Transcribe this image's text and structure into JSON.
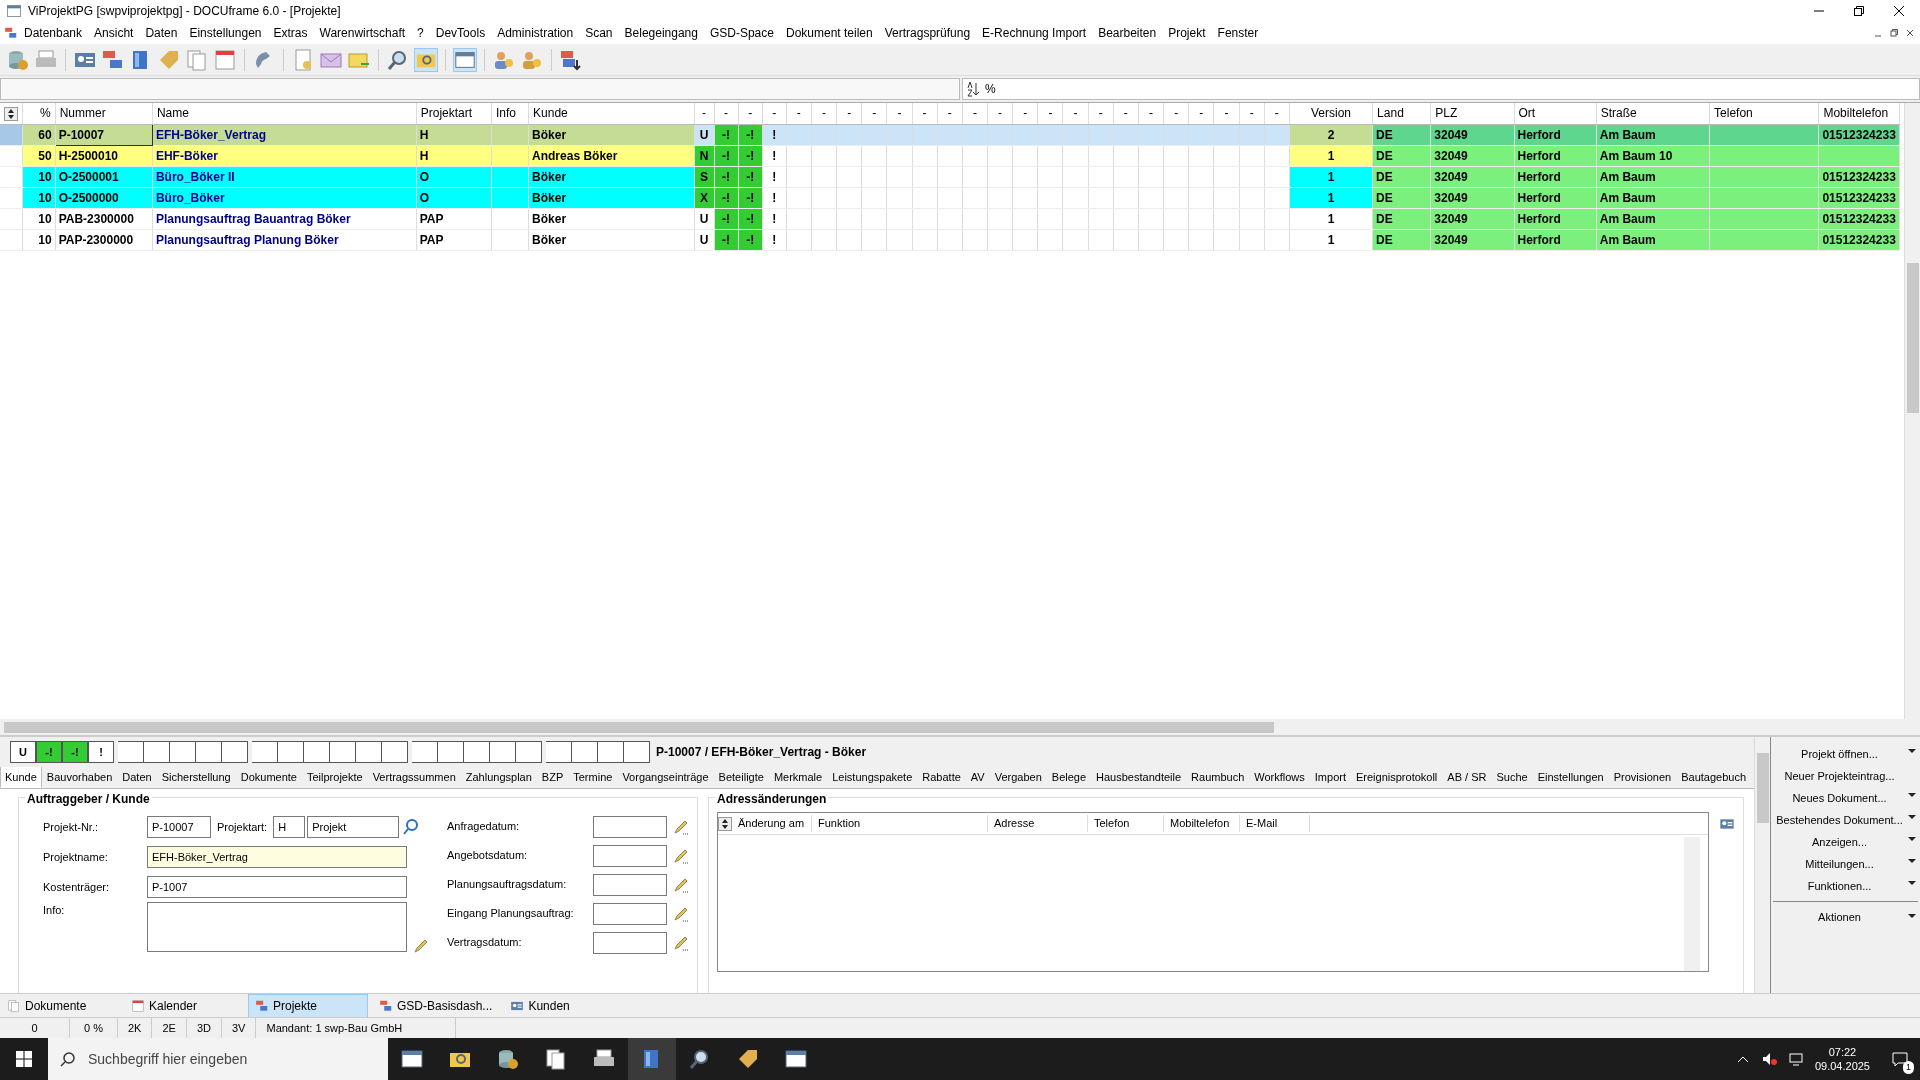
{
  "window": {
    "title": "ViProjektPG [swpviprojektpg] - DOCUframe 6.0 - [Projekte]"
  },
  "menu": [
    "Datenbank",
    "Ansicht",
    "Daten",
    "Einstellungen",
    "Extras",
    "Warenwirtschaft",
    "?",
    "DevTools",
    "Administration",
    "Scan",
    "Belegeingang",
    "GSD-Space",
    "Dokument teilen",
    "Vertragsprüfung",
    "E-Rechnung Import",
    "Bearbeiten",
    "Projekt",
    "Fenster"
  ],
  "filter": {
    "value": "%"
  },
  "table": {
    "columns": [
      "%",
      "Nummer",
      "Name",
      "Projektart",
      "Info",
      "Kunde",
      "-",
      "-",
      "-",
      "-",
      "-",
      "-",
      "-",
      "-",
      "-",
      "-",
      "-",
      "-",
      "-",
      "-",
      "-",
      "-",
      "-",
      "-",
      "-",
      "-",
      "-",
      "-",
      "-",
      "-",
      "Version",
      "Land",
      "PLZ",
      "Ort",
      "Straße",
      "Telefon",
      "Mobiltelefon"
    ],
    "rows": [
      {
        "pct": "60",
        "nummer": "P-10007",
        "name": "EFH-Böker_Vertrag",
        "projektart": "H",
        "kunde": "Böker",
        "marks": [
          "U",
          "-!",
          "-!",
          "!"
        ],
        "status_highlight": false,
        "version": "2",
        "land": "DE",
        "plz": "32049",
        "ort": "Herford",
        "strasse": "Am Baum",
        "mobil": "01512324233",
        "color": "#c4dc94",
        "selected": true
      },
      {
        "pct": "50",
        "nummer": "H-2500010",
        "name": "EHF-Böker",
        "projektart": "H",
        "kunde": "Andreas Böker",
        "marks": [
          "N",
          "-!",
          "-!",
          "!"
        ],
        "status_highlight": true,
        "version": "1",
        "land": "DE",
        "plz": "32049",
        "ort": "Herford",
        "strasse": "Am Baum 10",
        "color": "#ffff80",
        "selected": false
      },
      {
        "pct": "10",
        "nummer": "O-2500001",
        "name": "Büro_Böker II",
        "projektart": "O",
        "kunde": "Böker",
        "marks": [
          "S",
          "-!",
          "-!",
          "!"
        ],
        "status_highlight": true,
        "version": "1",
        "land": "DE",
        "plz": "32049",
        "ort": "Herford",
        "strasse": "Am Baum",
        "mobil": "01512324233",
        "color": "#00ffff",
        "selected": false
      },
      {
        "pct": "10",
        "nummer": "O-2500000",
        "name": "Büro_Böker",
        "projektart": "O",
        "kunde": "Böker",
        "marks": [
          "X",
          "-!",
          "-!",
          "!"
        ],
        "status_highlight": true,
        "version": "1",
        "land": "DE",
        "plz": "32049",
        "ort": "Herford",
        "strasse": "Am Baum",
        "mobil": "01512324233",
        "color": "#00ffff",
        "selected": false
      },
      {
        "pct": "10",
        "nummer": "PAB-2300000",
        "name": "Planungsauftrag Bauantrag Böker",
        "projektart": "PAP",
        "kunde": "Böker",
        "marks": [
          "U",
          "-!",
          "-!",
          "!"
        ],
        "status_highlight": false,
        "version": "1",
        "land": "DE",
        "plz": "32049",
        "ort": "Herford",
        "strasse": "Am Baum",
        "mobil": "01512324233",
        "selected": false
      },
      {
        "pct": "10",
        "nummer": "PAP-2300000",
        "name": "Planungsauftrag Planung Böker",
        "projektart": "PAP",
        "kunde": "Böker",
        "marks": [
          "U",
          "-!",
          "-!",
          "!"
        ],
        "status_highlight": false,
        "version": "1",
        "land": "DE",
        "plz": "32049",
        "ort": "Herford",
        "strasse": "Am Baum",
        "mobil": "01512324233",
        "selected": false
      }
    ]
  },
  "record": {
    "flags": [
      "U",
      "-!",
      "-!",
      "!"
    ],
    "title": "P-10007 / EFH-Böker_Vertrag - Böker"
  },
  "tabs": [
    {
      "label": "Kunde",
      "selected": true
    },
    {
      "label": "Bauvorhaben",
      "selected": false
    },
    {
      "label": "Daten",
      "selected": false
    },
    {
      "label": "Sicherstellung",
      "selected": false
    },
    {
      "label": "Dokumente",
      "selected": false
    },
    {
      "label": "Teilprojekte",
      "selected": false
    },
    {
      "label": "Vertragssummen",
      "selected": false
    },
    {
      "label": "Zahlungsplan",
      "selected": false
    },
    {
      "label": "BZP",
      "selected": false
    },
    {
      "label": "Termine",
      "selected": false
    },
    {
      "label": "Vorgangseinträge",
      "selected": false
    },
    {
      "label": "Beteiligte",
      "selected": false
    },
    {
      "label": "Merkmale",
      "selected": false
    },
    {
      "label": "Leistungspakete",
      "selected": false
    },
    {
      "label": "Rabatte",
      "selected": false
    },
    {
      "label": "AV",
      "selected": false
    },
    {
      "label": "Vergaben",
      "selected": false
    },
    {
      "label": "Belege",
      "selected": false
    },
    {
      "label": "Hausbestandteile",
      "selected": false
    },
    {
      "label": "Raumbuch",
      "selected": false
    },
    {
      "label": "Workflows",
      "selected": false
    },
    {
      "label": "Import",
      "selected": false
    },
    {
      "label": "Ereignisprotokoll",
      "selected": false
    },
    {
      "label": "AB / SR",
      "selected": false
    },
    {
      "label": "Suche",
      "selected": false
    },
    {
      "label": "Einstellungen",
      "selected": false
    },
    {
      "label": "Provisionen",
      "selected": false
    },
    {
      "label": "Bautagebuch",
      "selected": false
    }
  ],
  "customer": {
    "title": "Auftraggeber / Kunde",
    "projekt_nr": {
      "label": "Projekt-Nr.:",
      "value": "P-10007"
    },
    "projektart": {
      "label": "Projektart:",
      "code": "H",
      "value": "Projekt"
    },
    "projektname": {
      "label": "Projektname:",
      "value": "EFH-Böker_Vertrag"
    },
    "kostentraeger": {
      "label": "Kostenträger:",
      "value": "P-1007"
    },
    "info": {
      "label": "Info:"
    },
    "dates": [
      "Anfragedatum:",
      "Angebotsdatum:",
      "Planungsauftragsdatum:",
      "Eingang Planungsauftrag:",
      "Vertragsdatum:"
    ]
  },
  "address_changes": {
    "title": "Adressänderungen",
    "columns": [
      "Änderung am",
      "Funktion",
      "Adresse",
      "Telefon",
      "Mobiltelefon",
      "E-Mail"
    ]
  },
  "actions": [
    {
      "label": "Projekt öffnen...",
      "dropdown": true
    },
    {
      "label": "Neuer Projekteintrag...",
      "dropdown": false
    },
    {
      "label": "Neues Dokument...",
      "dropdown": true
    },
    {
      "label": "Bestehendes Dokument...",
      "dropdown": true
    },
    {
      "label": "Anzeigen...",
      "dropdown": true
    },
    {
      "label": "Mitteilungen...",
      "dropdown": true
    },
    {
      "label": "Funktionen...",
      "dropdown": true
    }
  ],
  "actions_footer": {
    "label": "Aktionen",
    "dropdown": true
  },
  "nav_tabs": [
    {
      "label": "Dokumente",
      "selected": false
    },
    {
      "label": "Kalender",
      "selected": false
    },
    {
      "label": "Projekte",
      "selected": true
    },
    {
      "label": "GSD-Basisdash...",
      "selected": false
    },
    {
      "label": "Kunden",
      "selected": false
    }
  ],
  "status_bar": [
    "0",
    "0 %",
    "2K",
    "2E",
    "3D",
    "3V",
    "Mandant: 1 swp-Bau GmbH"
  ],
  "taskbar": {
    "search_placeholder": "Suchbegriff hier eingeben",
    "time": "07:22",
    "date": "09.04.2025",
    "notification_count": "1"
  }
}
